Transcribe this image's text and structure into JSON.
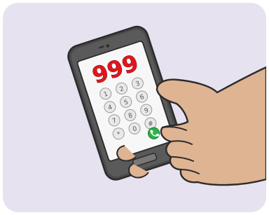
{
  "illustration": {
    "dialed_number": "999",
    "keypad_keys": [
      "1",
      "2",
      "3",
      "4",
      "5",
      "6",
      "7",
      "8",
      "9",
      "*",
      "0",
      "#"
    ],
    "call_icon": "phone-handset-icon",
    "colors": {
      "background": "#e6e2ef",
      "number": "#e5141b",
      "phone_body": "#4a4a4a",
      "screen": "#f7f7f7",
      "key_fill": "#e9e9ea",
      "call_button": "#2cb34a",
      "skin": "#dfb493",
      "outline": "#2b2b2b"
    }
  }
}
